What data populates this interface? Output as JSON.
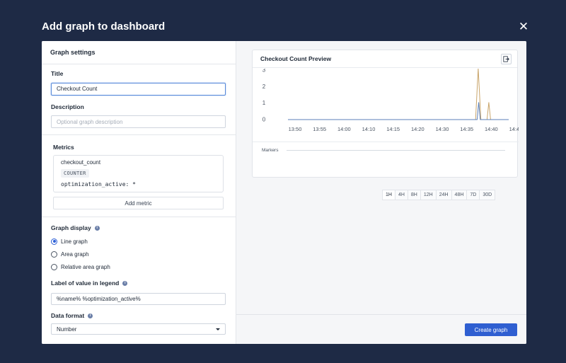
{
  "modal": {
    "title": "Add graph to dashboard",
    "close_symbol": "✕"
  },
  "settings": {
    "header": "Graph settings",
    "title_label": "Title",
    "title_value": "Checkout Count",
    "description_label": "Description",
    "description_placeholder": "Optional graph description",
    "metrics_label": "Metrics",
    "metric": {
      "name": "checkout_count",
      "type": "COUNTER",
      "filter": "optimization_active: *"
    },
    "add_metric_label": "Add metric",
    "graph_display_label": "Graph display",
    "graph_display_options": [
      {
        "label": "Line graph",
        "checked": true
      },
      {
        "label": "Area graph",
        "checked": false
      },
      {
        "label": "Relative area graph",
        "checked": false
      }
    ],
    "legend_label": "Label of value in legend",
    "legend_value": "%name% %optimization_active%",
    "data_format_label": "Data format",
    "data_format_value": "Number"
  },
  "preview": {
    "title": "Checkout Count Preview",
    "markers_label": "Markers",
    "time_ranges": [
      "1H",
      "4H",
      "8H",
      "12H",
      "24H",
      "48H",
      "7D",
      "30D"
    ],
    "create_button": "Create graph"
  },
  "colors": {
    "series_orange": "#c9a56b",
    "series_blue": "#5b7fb8",
    "primary": "#2f5fd1",
    "backdrop": "#1e2a45"
  },
  "chart_data": {
    "type": "line",
    "title": "Checkout Count Preview",
    "x_ticks": [
      "13:50",
      "13:55",
      "14:00",
      "14:10",
      "14:15",
      "14:20",
      "14:30",
      "14:35",
      "14:40",
      "14:45"
    ],
    "y_ticks": [
      0,
      1,
      2,
      3
    ],
    "ylim": [
      0,
      3
    ],
    "legend": "none",
    "series": [
      {
        "color": "#c9a56b",
        "points": [
          [
            0,
            0
          ],
          [
            0.85,
            0
          ],
          [
            0.862,
            3.1
          ],
          [
            0.874,
            0
          ],
          [
            0.902,
            0
          ],
          [
            0.91,
            1.05
          ],
          [
            0.918,
            0
          ],
          [
            1,
            0
          ]
        ]
      },
      {
        "color": "#5b7fb8",
        "points": [
          [
            0,
            0
          ],
          [
            0.857,
            0
          ],
          [
            0.864,
            1.05
          ],
          [
            0.871,
            0
          ],
          [
            1,
            0
          ]
        ]
      }
    ]
  }
}
